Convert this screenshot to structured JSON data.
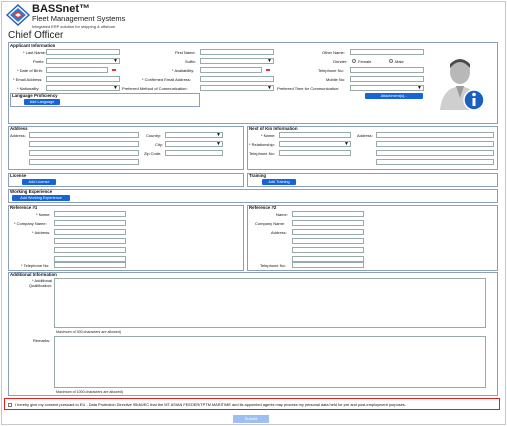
{
  "header": {
    "logo_title": "BASSnet™",
    "logo_subtitle": "Fleet Management Systems",
    "logo_tagline": "Integrated ERP solution for shipping & offshore",
    "page_title": "Chief Officer"
  },
  "applicant": {
    "section_title": "Applicant Information",
    "last_name": "* Last Name:",
    "first_name": "First Name:",
    "other_name": "Other Name:",
    "prefix": "Prefix:",
    "suffix": "Suffix:",
    "gender": "Gender:",
    "female": "Female",
    "male": "Male",
    "dob": "* Date of Birth:",
    "availability": "* Availability:",
    "telephone": "Telephone No:",
    "email": "* Email Address:",
    "confirm_email": "* Confirmed Email Address:",
    "mobile": "Mobile No:",
    "nationality": "* Nationality:",
    "pref_method": "Preferred Method of Communication:",
    "pref_time": "Preferred Time for Communication:",
    "attachments": "Attachment(s)..."
  },
  "language": {
    "section_title": "Language Proficiency",
    "add": "Add Language"
  },
  "address": {
    "section_title": "Address",
    "address": "Address:",
    "country": "Country:",
    "city": "City:",
    "zip": "Zip Code:"
  },
  "kin": {
    "section_title": "Next of Kin Information",
    "name": "* Name:",
    "relationship": "* Relationship:",
    "telephone": "Telephone No:",
    "address": "Address:"
  },
  "license": {
    "section_title": "License",
    "add": "Add License"
  },
  "training": {
    "section_title": "Training",
    "add": "Add Training"
  },
  "experience": {
    "section_title": "Working Experience",
    "add": "Add Working Experience"
  },
  "ref1": {
    "section_title": "Reference #1",
    "name": "* Name:",
    "company": "* Company Name:",
    "address": "* Address:",
    "telephone": "* Telephone No:"
  },
  "ref2": {
    "section_title": "Reference #2",
    "name": "Name:",
    "company": "Company Name:",
    "address": "Address:",
    "telephone": "Telephone No:"
  },
  "additional": {
    "section_title": "Additional Information",
    "qualification": "* Additional Qualification:",
    "qual_note": "Maximum of 300 characters are allowed)",
    "remarks": "Remarks:",
    "remarks_note": "Maximum of 1000 characters are allowed)"
  },
  "consent": {
    "text": "I hereby give my consent pursuant to EU - Data Protection Directive 95/46/EC that the MT ASIAN FEEDER/TPTM MARITIME and its appointed agents may process my personal data held for pre and post-employment purposes."
  },
  "submit": "Submit",
  "colors": {
    "accent": "#1565d8",
    "consent_border": "#e02020"
  }
}
